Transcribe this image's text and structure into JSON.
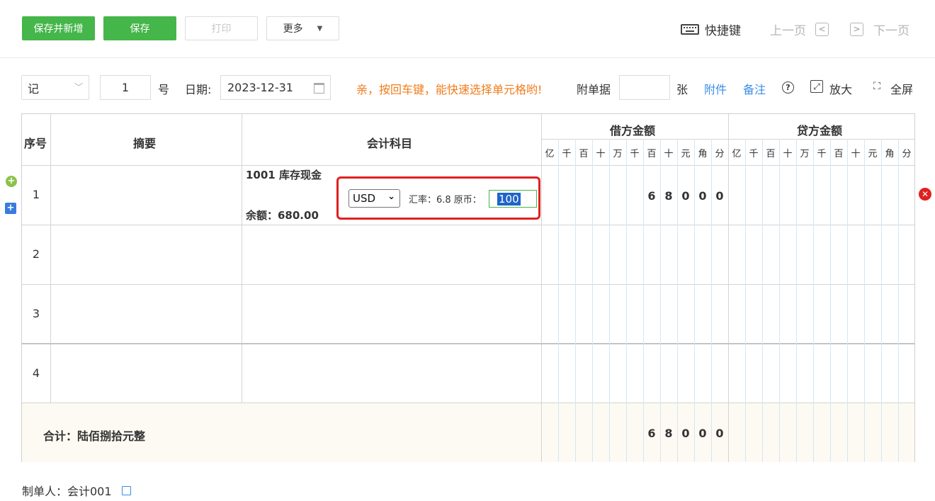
{
  "toolbar": {
    "save_new": "保存并新增",
    "save": "保存",
    "print": "打印",
    "more": "更多",
    "shortcut": "快捷键",
    "prev": "上一页",
    "next": "下一页",
    "prev_icon": "chevron-left-icon",
    "next_icon": "chevron-right-icon"
  },
  "voucher": {
    "word": "记",
    "number": "1",
    "number_suffix": "号",
    "date_label": "日期:",
    "date": "2023-12-31",
    "hint": "亲，按回车键，能快速选择单元格哟!",
    "attach_label": "附单据",
    "attach_unit": "张",
    "attachment_link": "附件",
    "remark_link": "备注",
    "zoom": "放大",
    "fullscreen": "全屏"
  },
  "table": {
    "col_seq": "序号",
    "col_summary": "摘要",
    "col_account": "会计科目",
    "col_debit": "借方金额",
    "col_credit": "贷方金额",
    "digit_units": [
      "亿",
      "千",
      "百",
      "十",
      "万",
      "千",
      "百",
      "十",
      "元",
      "角",
      "分"
    ],
    "rows": [
      {
        "seq": "1",
        "account": "1001 库存现金",
        "balance": "余额：680.00",
        "currency": "USD",
        "fx_text": "汇率：6.8 原币：",
        "original_amount": "100",
        "debit_digits": [
          "",
          "",
          "",
          "",
          "",
          "",
          "6",
          "8",
          "0",
          "0",
          "0"
        ]
      },
      {
        "seq": "2"
      },
      {
        "seq": "3"
      },
      {
        "seq": "4"
      }
    ],
    "total_label": "合计：陆佰捌拾元整",
    "total_debit_digits": [
      "",
      "",
      "",
      "",
      "",
      "",
      "6",
      "8",
      "0",
      "0",
      "0"
    ]
  },
  "footer": {
    "maker": "制单人：会计001"
  },
  "colors": {
    "green": "#45b649",
    "hint_orange": "#f07c1b",
    "link_blue": "#3a8ee6",
    "highlight_red": "#e02020"
  }
}
